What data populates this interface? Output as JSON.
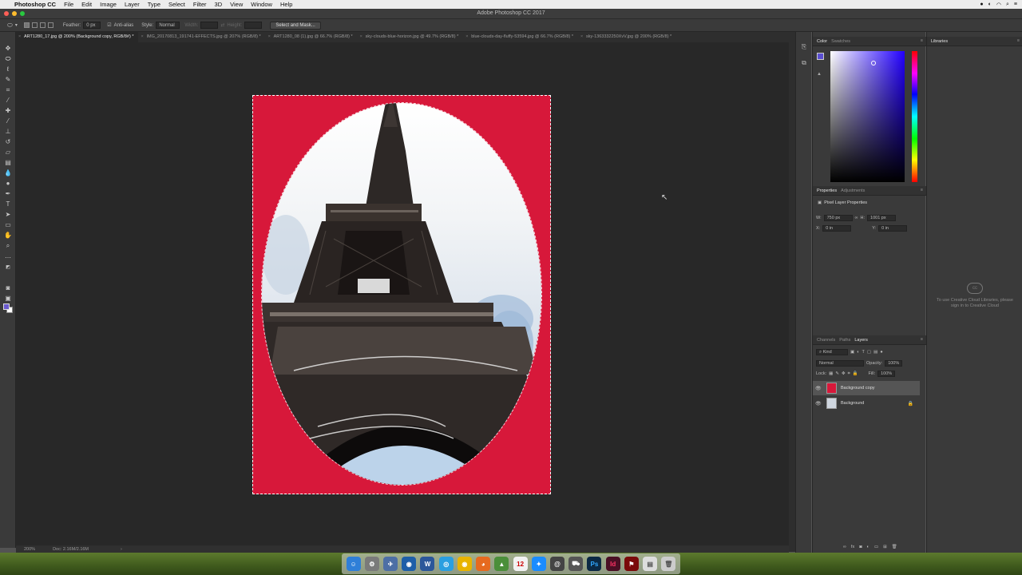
{
  "menubar": {
    "app_name": "Photoshop CC",
    "items": [
      "File",
      "Edit",
      "Image",
      "Layer",
      "Type",
      "Select",
      "Filter",
      "3D",
      "View",
      "Window",
      "Help"
    ]
  },
  "window": {
    "title": "Adobe Photoshop CC 2017"
  },
  "options_bar": {
    "feather_label": "Feather:",
    "feather_value": "0 px",
    "antialias_label": "Anti-alias",
    "style_label": "Style:",
    "style_value": "Normal",
    "width_label": "Width:",
    "height_label": "Height:",
    "select_mask_label": "Select and Mask..."
  },
  "tabs": [
    {
      "label": "ART1280_17.jpg @ 200% (Background copy, RGB/8#) *",
      "active": true
    },
    {
      "label": "IMG_20170813_191741-EFFECTS.jpg @ 207% (RGB/8) *",
      "active": false
    },
    {
      "label": "ART1280_08 (1).jpg @ 66.7% (RGB/8) *",
      "active": false
    },
    {
      "label": "sky-clouds-blue-horizon.jpg @ 49.7% (RGB/8) *",
      "active": false
    },
    {
      "label": "blue-clouds-day-fluffy-53594.jpg @ 66.7% (RGB/8) *",
      "active": false
    },
    {
      "label": "sky-1363332250XvV.jpg @ 200% (RGB/8) *",
      "active": false
    }
  ],
  "status": {
    "zoom": "200%",
    "doc": "Doc: 2.16M/2.16M"
  },
  "color_panel": {
    "tabs": [
      "Color",
      "Swatches"
    ],
    "foreground": "#5a4ed1",
    "background": "#ffffff"
  },
  "properties_panel": {
    "tabs": [
      "Properties",
      "Adjustments"
    ],
    "heading": "Pixel Layer Properties",
    "w_label": "W:",
    "w_value": "750 px",
    "h_label": "H:",
    "h_value": "1001 px",
    "x_label": "X:",
    "x_value": "0 in",
    "y_label": "Y:",
    "y_value": "0 in"
  },
  "layers_panel": {
    "tabs": [
      "Channels",
      "Paths",
      "Layers"
    ],
    "kind_label": "Kind",
    "blend_mode": "Normal",
    "opacity_label": "Opacity:",
    "opacity_value": "100%",
    "lock_label": "Lock:",
    "fill_label": "Fill:",
    "fill_value": "100%",
    "layers": [
      {
        "name": "Background copy",
        "selected": true
      },
      {
        "name": "Background",
        "selected": false
      }
    ]
  },
  "libraries_panel": {
    "title": "Libraries",
    "message": "To use Creative Cloud Libraries, please sign in to Creative Cloud"
  },
  "colors": {
    "canvas_bg": "#d7183a",
    "accent_selected_layer": "#555555"
  }
}
